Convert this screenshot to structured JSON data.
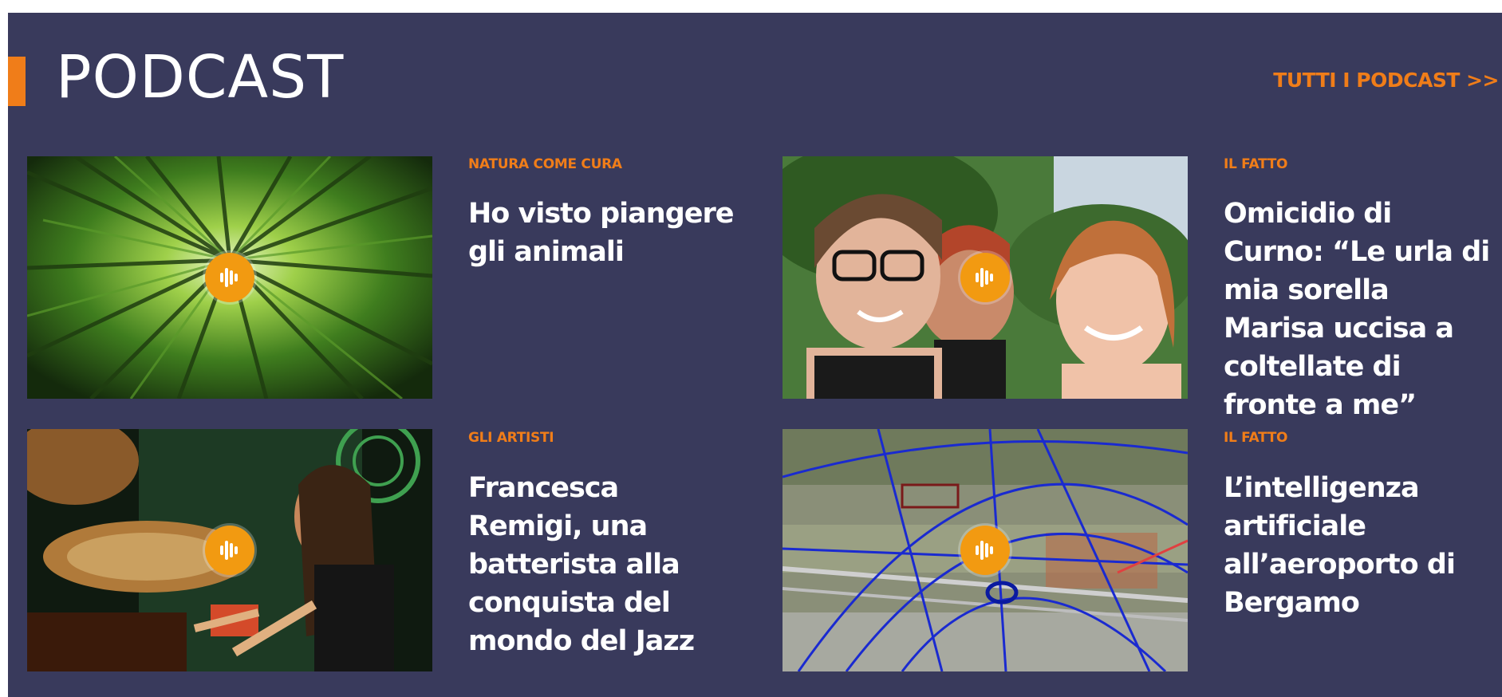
{
  "section": {
    "title": "PODCAST",
    "all_link": "TUTTI I PODCAST >>"
  },
  "cards": [
    {
      "kicker": "NATURA COME CURA",
      "headline": "Ho visto piangere gli animali",
      "image": "bamboo-forest-image"
    },
    {
      "kicker": "IL FATTO",
      "headline": "Omicidio di Curno: “Le urla di mia sorella Marisa uccisa a coltellate di fronte a me”",
      "image": "three-women-selfie-image"
    },
    {
      "kicker": "GLI ARTISTI",
      "headline": "Francesca Remigi, una batterista alla conquista del mondo del Jazz",
      "image": "drummer-image"
    },
    {
      "kicker": "IL FATTO",
      "headline": "L’intelligenza artificiale all’aeroporto di Bergamo",
      "image": "airport-map-image"
    }
  ],
  "icons": {
    "audio": "audio-waveform-icon"
  },
  "colors": {
    "background": "#393a5c",
    "accent": "#f07d19",
    "audio_badge": "#f29a11",
    "text": "#ffffff"
  }
}
